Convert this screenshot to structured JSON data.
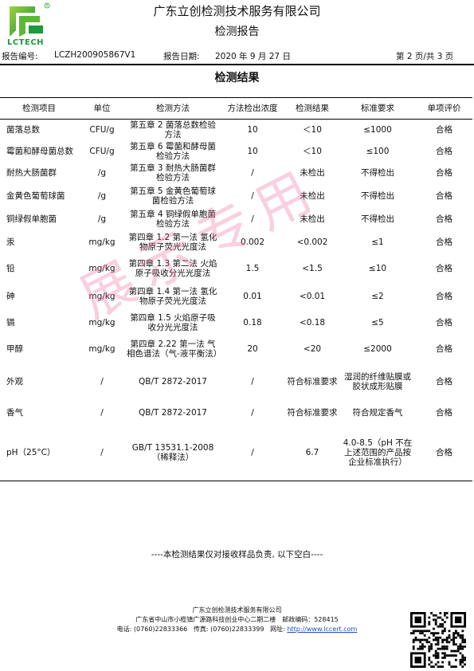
{
  "header": {
    "logo_text": "LCTECH",
    "company": "广东立创检测技术服务有限公司",
    "title": "检测报告"
  },
  "meta": {
    "report_no_label": "报告编号:",
    "report_no": "LCZH200905867V1",
    "date_label": "报告日期:",
    "date": "2020 年 9 月 27 日",
    "page": "第 2 页/共 3 页"
  },
  "results_title": "检测结果",
  "table": {
    "headers": [
      "检测项目",
      "单位",
      "检测方法",
      "方法检出浓度",
      "检测结果",
      "标准要求",
      "单项评价"
    ],
    "rows": [
      {
        "item": "菌落总数",
        "unit": "CFU/g",
        "method": "第五章 2 菌落总数检验方法",
        "limit": "10",
        "result": "＜10",
        "standard": "≤1000",
        "eval": "合格"
      },
      {
        "item": "霉菌和酵母菌总数",
        "unit": "CFU/g",
        "method": "第五章 6 霉菌和酵母菌检验方法",
        "limit": "10",
        "result": "＜10",
        "standard": "≤100",
        "eval": "合格"
      },
      {
        "item": "耐热大肠菌群",
        "unit": "/g",
        "method": "第五章 3 耐热大肠菌群检验方法",
        "limit": "/",
        "result": "未检出",
        "standard": "不得检出",
        "eval": "合格"
      },
      {
        "item": "金黄色葡萄球菌",
        "unit": "/g",
        "method": "第五章 5 金黄色葡萄球菌检验方法",
        "limit": "/",
        "result": "未检出",
        "standard": "不得检出",
        "eval": "合格"
      },
      {
        "item": "铜绿假单胞菌",
        "unit": "/g",
        "method": "第五章 4 铜绿假单胞菌检验方法",
        "limit": "/",
        "result": "未检出",
        "standard": "不得检出",
        "eval": "合格"
      },
      {
        "item": "汞",
        "unit": "mg/kg",
        "method": "第四章 1.2 第一法 氢化物原子荧光光度法",
        "limit": "0.002",
        "result": "<0.002",
        "standard": "≤1",
        "eval": "合格"
      },
      {
        "item": "铅",
        "unit": "mg/kg",
        "method": "第四章 1.3 第二法 火焰原子吸收分光光度法",
        "limit": "1.5",
        "result": "<1.5",
        "standard": "≤10",
        "eval": "合格"
      },
      {
        "item": "砷",
        "unit": "mg/kg",
        "method": "第四章 1.4 第一法 氢化物原子荧光光度法",
        "limit": "0.01",
        "result": "<0.01",
        "standard": "≤2",
        "eval": "合格"
      },
      {
        "item": "镉",
        "unit": "mg/kg",
        "method": "第四章 1.5 火焰原子吸收分光光度法",
        "limit": "0.18",
        "result": "<0.18",
        "standard": "≤5",
        "eval": "合格"
      },
      {
        "item": "甲醇",
        "unit": "mg/kg",
        "method": "第四章 2.22 第一法 气相色谱法（气-液平衡法）",
        "limit": "20",
        "result": "<20",
        "standard": "≤2000",
        "eval": "合格"
      },
      {
        "item": "外观",
        "unit": "/",
        "method": "QB/T 2872-2017",
        "limit": "/",
        "result": "符合标准要求",
        "standard": "湿润的纤维贴膜或胶状成形贴膜",
        "eval": "合格"
      },
      {
        "item": "香气",
        "unit": "/",
        "method": "QB/T 2872-2017",
        "limit": "/",
        "result": "符合标准要求",
        "standard": "符合规定香气",
        "eval": "合格"
      },
      {
        "item": "pH（25°C）",
        "unit": "/",
        "method": "GB/T 13531.1-2008（稀释法）",
        "limit": "/",
        "result": "6.7",
        "standard": "4.0-8.5（pH 不在上述范围的产品按企业标准执行）",
        "eval": "合格"
      }
    ]
  },
  "footnote": "----本检测结果仅对接收样品负责, 以下空白----",
  "footer": {
    "company": "广东立创检测技术服务有限公司",
    "address": "广东省中山市小榄镇广源路科技创业中心二期二楼　邮政编码：528415",
    "tel_label": "电话:",
    "tel": "(0760)22833366",
    "fax_label": "传真:",
    "fax": "(0760)22833399",
    "web_label": "网址:",
    "web": "http://www.lccert.com"
  },
  "watermark": "展示专用",
  "colors": {
    "logo_green": "#1a9a3a",
    "watermark": "#eb648c",
    "link": "#1e50c8"
  }
}
